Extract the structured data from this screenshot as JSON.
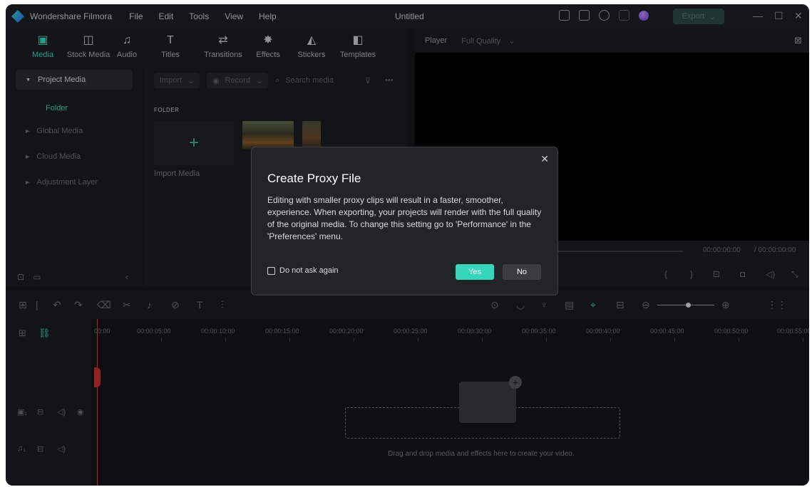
{
  "titlebar": {
    "app_name": "Wondershare Filmora",
    "menu": [
      "File",
      "Edit",
      "Tools",
      "View",
      "Help"
    ],
    "document_title": "Untitled",
    "export_label": "Export",
    "icons": [
      "layout-icon",
      "save-icon",
      "cloud-upload-icon",
      "grid-icon",
      "avatar"
    ]
  },
  "top_tabs": [
    {
      "label": "Media",
      "icon": "media-icon",
      "active": true
    },
    {
      "label": "Stock Media",
      "icon": "stock-media-icon",
      "active": false
    },
    {
      "label": "Audio",
      "icon": "music-note-icon",
      "active": false
    },
    {
      "label": "Titles",
      "icon": "title-t-icon",
      "active": false
    },
    {
      "label": "Transitions",
      "icon": "transitions-icon",
      "active": false
    },
    {
      "label": "Effects",
      "icon": "effects-icon",
      "active": false
    },
    {
      "label": "Stickers",
      "icon": "stickers-icon",
      "active": false
    },
    {
      "label": "Templates",
      "icon": "templates-icon",
      "active": false
    }
  ],
  "sidebar": {
    "items": [
      "Project Media",
      "Global Media",
      "Cloud Media",
      "Adjustment Layer"
    ],
    "folder": "Folder"
  },
  "media": {
    "import_label": "Import",
    "record_label": "Record",
    "search_placeholder": "Search media",
    "folder_heading": "FOLDER",
    "import_media_label": "Import Media"
  },
  "player": {
    "label": "Player",
    "quality": "Full Quality",
    "current_time": "00:00:00:00",
    "total_time": "/ 00:00:00:00"
  },
  "timeline": {
    "ruler": [
      "00:00",
      "00:00:05:00",
      "00:00:10:00",
      "00:00:15:00",
      "00:00:20:00",
      "00:00:25:00",
      "00:00:30:00",
      "00:00:35:00",
      "00:00:40:00",
      "00:00:45:00",
      "00:00:50:00",
      "00:00:55:00"
    ],
    "drop_text": "Drag and drop media and effects here to create your video."
  },
  "modal": {
    "title": "Create Proxy File",
    "body": "Editing with smaller proxy clips will result in a faster, smoother, experience. When exporting, your projects will render with the full quality of the original media. To change this setting go to 'Performance' in the 'Preferences' menu.",
    "checkbox_label": "Do not ask again",
    "yes_label": "Yes",
    "no_label": "No"
  },
  "colors": {
    "accent": "#36d6bd",
    "background": "#17181b",
    "panel": "#1b1c20",
    "modal": "#232428",
    "playhead": "#e03a3a"
  }
}
